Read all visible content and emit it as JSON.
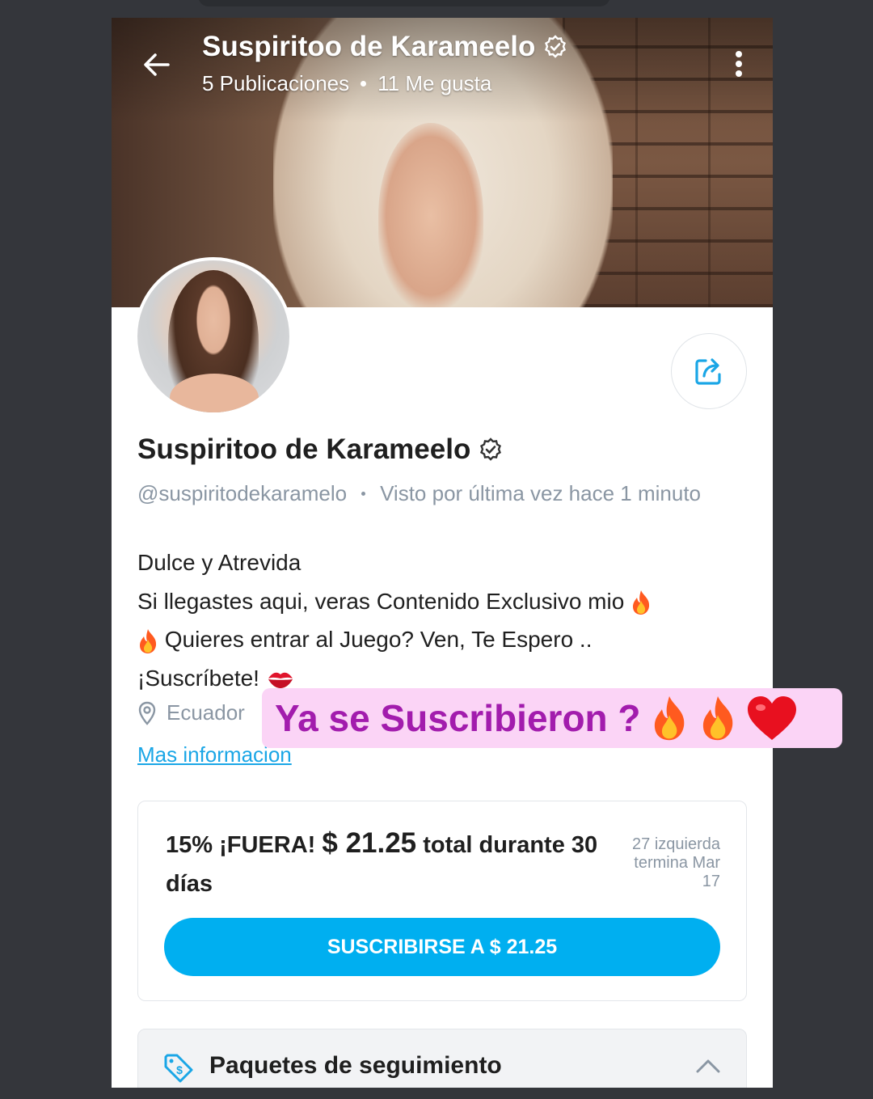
{
  "header": {
    "title": "Suspiritoo de Karameelo",
    "posts": "5 Publicaciones",
    "likes": "11 Me gusta"
  },
  "profile": {
    "name": "Suspiritoo de Karameelo",
    "handle": "@suspiritodekaramelo",
    "last_seen": "Visto por última vez hace 1 minuto",
    "bio": [
      "Dulce y Atrevida",
      "Si llegastes aqui, veras Contenido Exclusivo mio",
      "Quieres entrar al Juego? Ven, Te Espero ..",
      "¡Suscríbete!"
    ],
    "location": "Ecuador",
    "more_info": "Mas informacion"
  },
  "offer": {
    "discount": "15% ¡FUERA!",
    "price": "$ 21.25",
    "duration": "total durante 30 días",
    "meta": [
      "27 izquierda",
      "termina Mar",
      "17"
    ],
    "button_label": "SUSCRIBIRSE A $ 21.25"
  },
  "bundles": {
    "label": "Paquetes de seguimiento"
  },
  "sticker": {
    "text": "Ya se Suscribieron ?"
  },
  "colors": {
    "accent": "#00aff0",
    "link": "#1aa6e6",
    "sticker_bg": "#fbd4f6",
    "sticker_text": "#a21cad"
  },
  "icons": [
    "back-arrow-icon",
    "verified-icon",
    "kebab-menu-icon",
    "share-icon",
    "location-pin-icon",
    "tag-dollar-icon",
    "chevron-up-icon",
    "fire-emoji-icon",
    "kiss-emoji-icon",
    "heart-emoji-icon"
  ]
}
